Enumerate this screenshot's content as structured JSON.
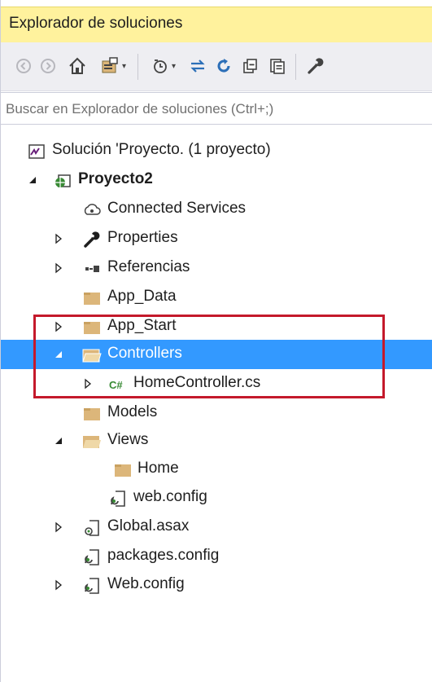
{
  "panel": {
    "title": "Explorador de soluciones"
  },
  "toolbar": {
    "buttons": [
      "back-icon",
      "forward-icon",
      "home-icon",
      "switch-views-icon",
      "pending-changes-icon",
      "sync-icon",
      "refresh-icon",
      "collapse-all-icon",
      "show-all-files-icon",
      "properties-icon"
    ]
  },
  "search": {
    "placeholder": "Buscar en Explorador de soluciones (Ctrl+;)"
  },
  "tree": {
    "solution": "Solución 'Proyecto.   (1 proyecto)",
    "project": "Proyecto2",
    "connected_services": "Connected Services",
    "properties": "Properties",
    "references": "Referencias",
    "app_data": "App_Data",
    "app_start": "App_Start",
    "controllers": "Controllers",
    "home_controller": "HomeController.cs",
    "models": "Models",
    "views": "Views",
    "home": "Home",
    "views_web_config": "web.config",
    "global_asax": "Global.asax",
    "packages_config": "packages.config",
    "web_config": "Web.config"
  },
  "colors": {
    "title_bar": "#fff29d",
    "selection": "#3399ff",
    "highlight_box": "#c4192b",
    "folder": "#dcb67a"
  }
}
